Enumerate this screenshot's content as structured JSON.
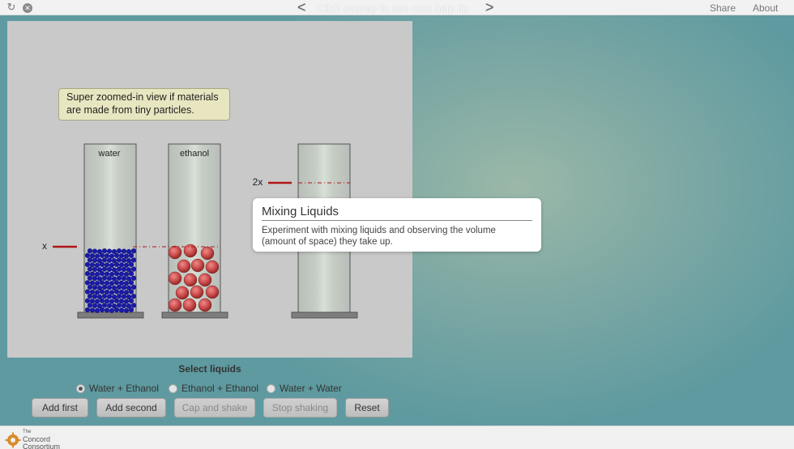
{
  "topbar": {
    "help_prev": "<",
    "help_text": "Click overlay to see next help tip",
    "help_next": ">",
    "share": "Share",
    "about": "About"
  },
  "sim": {
    "callout": "Super zoomed-in view if materials are made from tiny particles.",
    "cylinders": [
      {
        "label": "water"
      },
      {
        "label": "ethanol"
      },
      {
        "label": ""
      }
    ],
    "marker_x": "x",
    "marker_2x": "2x",
    "colors": {
      "water_particle": "#1a1aa8",
      "ethanol_particle": "#c94a4a",
      "marker": "#b01515"
    }
  },
  "tooltip": {
    "title": "Mixing Liquids",
    "body": "Experiment with mixing liquids and observing the volume (amount of space) they take up."
  },
  "controls": {
    "select_label": "Select liquids",
    "radios": [
      {
        "label": "Water + Ethanol",
        "selected": true
      },
      {
        "label": "Ethanol + Ethanol",
        "selected": false
      },
      {
        "label": "Water + Water",
        "selected": false
      }
    ],
    "buttons": {
      "add_first": "Add first",
      "add_second": "Add second",
      "cap_shake": "Cap and shake",
      "stop_shaking": "Stop shaking",
      "reset": "Reset"
    }
  },
  "footer": {
    "logo_small": "The",
    "logo_line1": "Concord",
    "logo_line2": "Consortium"
  }
}
